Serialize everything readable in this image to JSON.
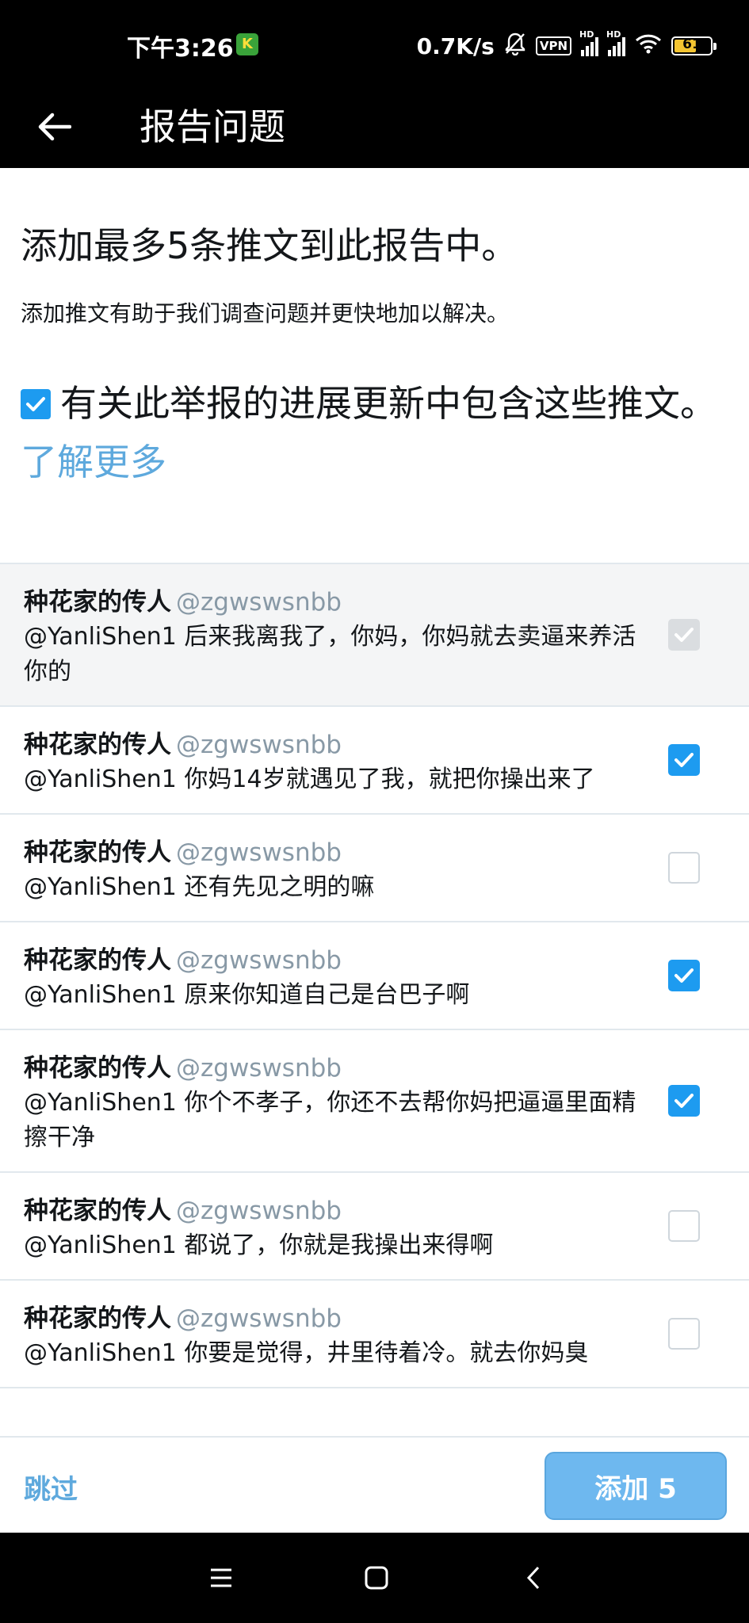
{
  "status_bar": {
    "time": "下午3:26",
    "app_icon_letter": "K",
    "net_speed": "0.7K/s",
    "vpn": "VPN",
    "hd": "HD",
    "battery": "61"
  },
  "app_bar": {
    "title": "报告问题"
  },
  "content": {
    "heading": "添加最多5条推文到此报告中。",
    "subtext": "添加推文有助于我们调查问题并更快地加以解决。",
    "include_text": "有关此举报的进展更新中包含这些推文。",
    "learn_more": "了解更多"
  },
  "tweets": [
    {
      "name": "种花家的传人",
      "handle": "@zgwswsnbb",
      "text": "@YanliShen1 后来我离我了，你妈，你妈就去卖逼来养活你的",
      "state": "disabled"
    },
    {
      "name": "种花家的传人",
      "handle": "@zgwswsnbb",
      "text": "@YanliShen1 你妈14岁就遇见了我，就把你操出来了",
      "state": "checked"
    },
    {
      "name": "种花家的传人",
      "handle": "@zgwswsnbb",
      "text": "@YanliShen1 还有先见之明的嘛",
      "state": "unchecked"
    },
    {
      "name": "种花家的传人",
      "handle": "@zgwswsnbb",
      "text": "@YanliShen1 原来你知道自己是台巴子啊",
      "state": "checked"
    },
    {
      "name": "种花家的传人",
      "handle": "@zgwswsnbb",
      "text": "@YanliShen1 你个不孝子，你还不去帮你妈把逼逼里面精擦干净",
      "state": "checked"
    },
    {
      "name": "种花家的传人",
      "handle": "@zgwswsnbb",
      "text": "@YanliShen1 都说了，你就是我操出来得啊",
      "state": "unchecked"
    },
    {
      "name": "种花家的传人",
      "handle": "@zgwswsnbb",
      "text": "@YanliShen1 你要是觉得，井里待着冷。就去你妈臭",
      "state": "unchecked"
    }
  ],
  "footer": {
    "skip_label": "跳过",
    "add_label": "添加 5"
  },
  "colors": {
    "accent": "#1d9bf0",
    "link": "#5ea9dd",
    "add_button": "#6eb8ef"
  }
}
